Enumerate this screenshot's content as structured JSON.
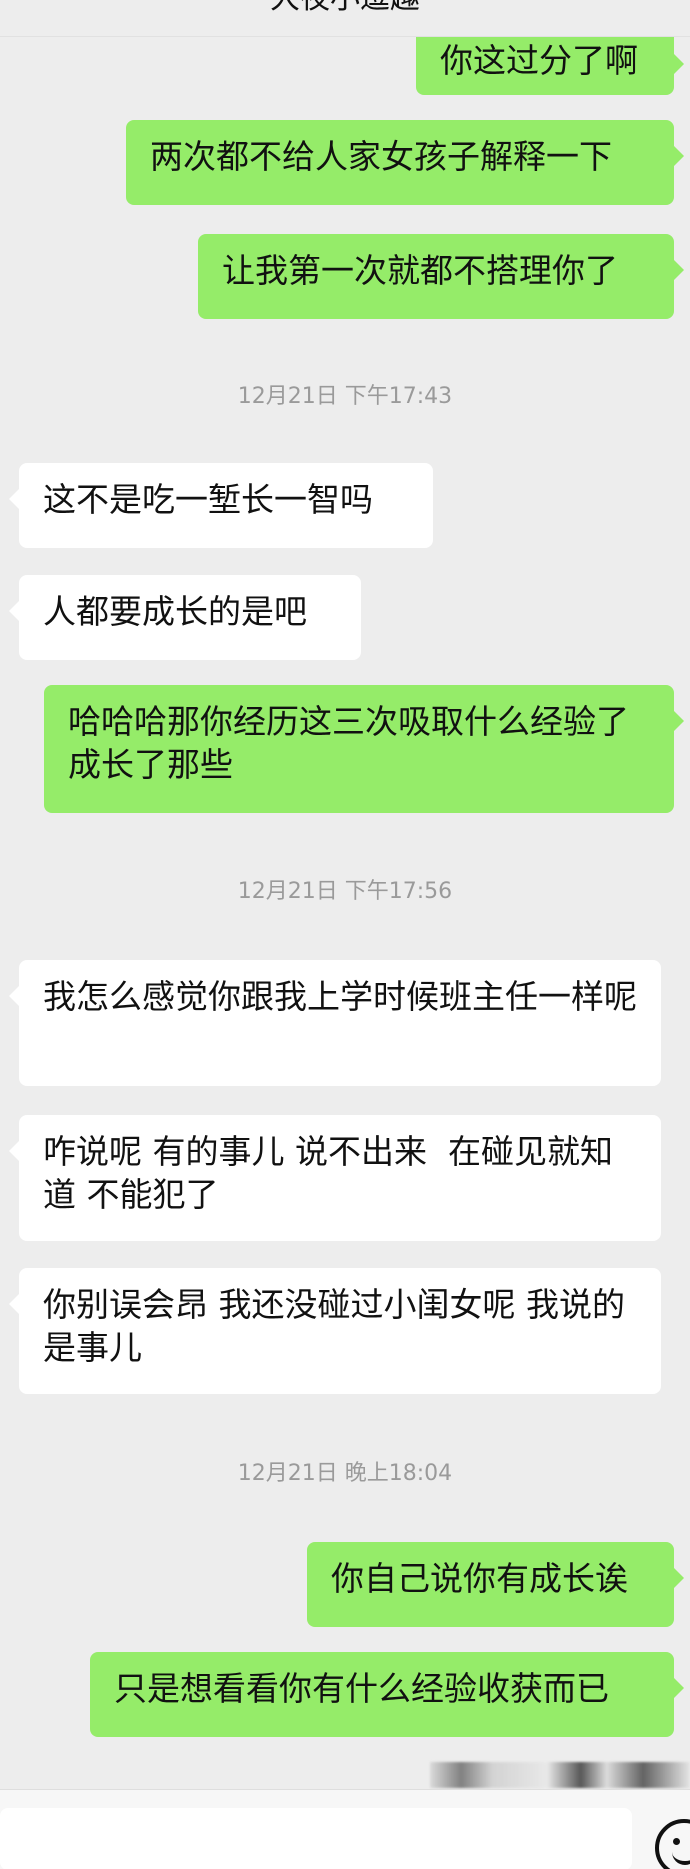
{
  "header": {
    "title": "大夜小逗趣"
  },
  "messages": [
    {
      "side": "out",
      "text": "你这过分了啊"
    },
    {
      "side": "out",
      "text": "两次都不给人家女孩子解释一下"
    },
    {
      "side": "out",
      "text": "让我第一次就都不搭理你了"
    },
    {
      "side": "in",
      "text": "这不是吃一堑长一智吗"
    },
    {
      "side": "in",
      "text": "人都要成长的是吧"
    },
    {
      "side": "out",
      "text": "哈哈哈那你经历这三次吸取什么经验了成长了那些"
    },
    {
      "side": "in",
      "text": "我怎么感觉你跟我上学时候班主任一样呢"
    },
    {
      "side": "in",
      "text": "咋说呢 有的事儿 说不出来  在碰见就知道 不能犯了"
    },
    {
      "side": "in",
      "text": "你别误会昂 我还没碰过小闺女呢 我说的是事儿"
    },
    {
      "side": "out",
      "text": "你自己说你有成长诶"
    },
    {
      "side": "out",
      "text": "只是想看看你有什么经验收获而已"
    }
  ],
  "timestamps": [
    "12月21日 下午17:43",
    "12月21日 下午17:56",
    "12月21日 晚上18:04"
  ],
  "input": {
    "placeholder": ""
  },
  "icons": {
    "emoji": "smile-icon"
  }
}
